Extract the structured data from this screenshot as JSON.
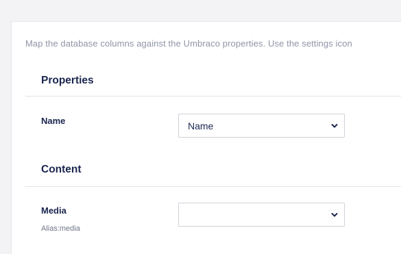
{
  "intro_text": "Map the database columns against the Umbraco properties. Use the settings icon",
  "sections": [
    {
      "title": "Properties",
      "fields": [
        {
          "label": "Name",
          "alias": "",
          "selected": "Name"
        }
      ]
    },
    {
      "title": "Content",
      "fields": [
        {
          "label": "Media",
          "alias": "Alias:media",
          "selected": ""
        }
      ]
    }
  ],
  "icons": {
    "dropdown": "chevron-down-icon"
  },
  "colors": {
    "text_primary": "#1b264f",
    "text_muted": "#8f95a6",
    "page_background": "#f3f3f5"
  }
}
